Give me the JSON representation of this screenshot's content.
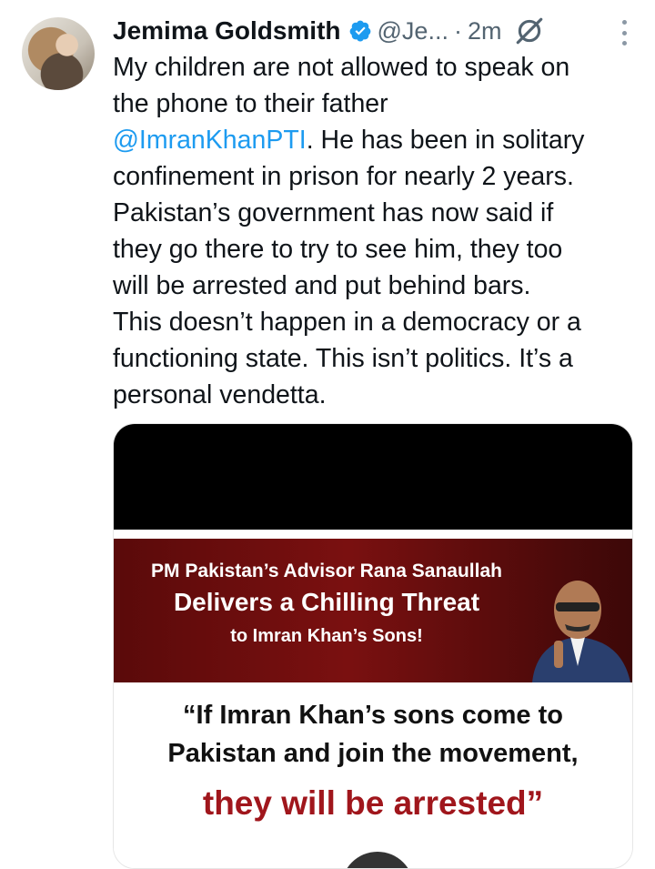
{
  "author": {
    "name": "Jemima Goldsmith",
    "handle": "@Je...",
    "separator": "·",
    "time": "2m"
  },
  "icons": [
    "verified-badge-icon",
    "grok-icon",
    "more-icon"
  ],
  "colors": {
    "mention": "#1d9bf0",
    "verified": "#1d9bf0",
    "banner": "#7a1010",
    "quote_emphasis": "#a0161c"
  },
  "tweet": {
    "line1": "My children are not allowed to speak on",
    "line2": "the phone  to their father",
    "mention": "@ImranKhanPTI",
    "line3_rest": ". He has been in solitary",
    "line4": "confinement in prison for nearly 2 years.",
    "line5": "Pakistan’s government has now said if",
    "line6": "they go there to try to see him, they too",
    "line7": "will be arrested and put behind bars.",
    "line8": "This doesn’t happen in a democracy or a",
    "line9": "functioning state. This isn’t politics. It’s a",
    "line10": "personal vendetta."
  },
  "media": {
    "banner_line1": "PM Pakistan’s Advisor Rana Sanaullah",
    "banner_line2": "Delivers a Chilling Threat",
    "banner_line3": "to Imran Khan’s Sons!",
    "quote_line1": "“If Imran Khan’s sons come to",
    "quote_line2": "Pakistan and join the movement,",
    "quote_line3": "they will be arrested”"
  }
}
